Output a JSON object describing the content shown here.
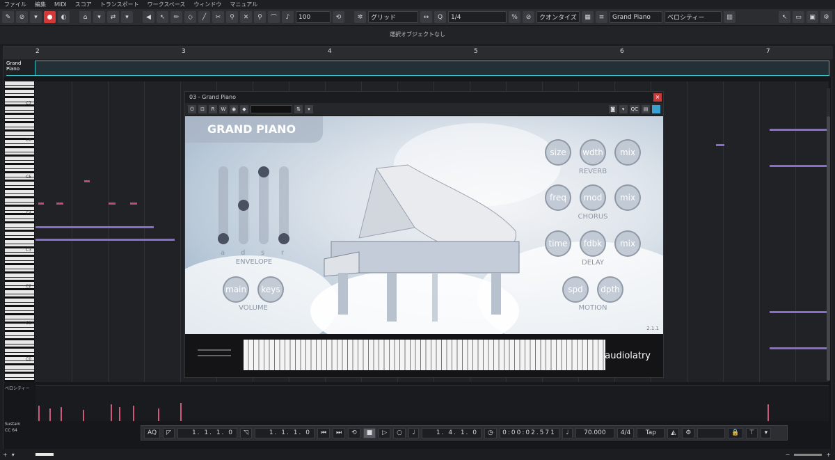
{
  "menu": [
    "ファイル",
    "編集",
    "MIDI",
    "スコア",
    "トランスポート",
    "ワークスペース",
    "ウィンドウ",
    "マニュアル"
  ],
  "toolbar": {
    "quantize_value": "100",
    "grid_label": "グリッド",
    "quant_label": "1/4",
    "quantize_mode": "クオンタイズ",
    "instrument": "Grand Piano",
    "velocity_label": "ベロシティー"
  },
  "info_line": "選択オブジェクトなし",
  "ruler": {
    "marks": [
      "2",
      "3",
      "4",
      "5",
      "6",
      "7"
    ]
  },
  "track_name": "Grand Piano",
  "key_labels": [
    "C7",
    "C6",
    "C5",
    "C4",
    "C3",
    "C2",
    "C1",
    "C0"
  ],
  "velocity_lane_label": "ベロシティー",
  "cc_lane_label": [
    "Sustain",
    "CC 64"
  ],
  "plugin": {
    "window_title": "03 - Grand Piano",
    "tool_labels": [
      "R",
      "W"
    ],
    "qc_label": "QC",
    "product_title": "GRAND PIANO",
    "envelope": {
      "label": "ENVELOPE",
      "letters": [
        "a",
        "d",
        "s",
        "r"
      ],
      "levels": [
        0.0,
        0.5,
        1.0,
        0.0
      ]
    },
    "volume": {
      "label": "VOLUME",
      "knobs": [
        "main",
        "keys"
      ]
    },
    "reverb": {
      "label": "REVERB",
      "knobs": [
        "size",
        "wdth",
        "mix"
      ]
    },
    "chorus": {
      "label": "CHORUS",
      "knobs": [
        "freq",
        "mod",
        "mix"
      ]
    },
    "delay": {
      "label": "DELAY",
      "knobs": [
        "time",
        "fdbk",
        "mix"
      ]
    },
    "motion": {
      "label": "MOTION",
      "knobs": [
        "spd",
        "dpth"
      ]
    },
    "brand": "audiolatry",
    "version": "2.1.1"
  },
  "transport": {
    "aq": "AQ",
    "left_locator": "1. 1. 1. 0",
    "right_locator": "1. 1. 1. 0",
    "position": "1. 4. 1. 0",
    "time": "0:00:02.571",
    "tempo": "70.000",
    "signature": "4/4",
    "tap": "Tap"
  }
}
